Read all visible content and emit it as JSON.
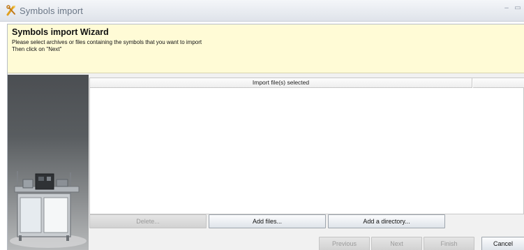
{
  "window": {
    "title": "Symbols import",
    "icon": "wrench-pencil-icon",
    "minimize_glyph": "–",
    "maximize_glyph": "▭"
  },
  "banner": {
    "wizard_title": "Symbols import Wizard",
    "line1": "Please select archives or files containing the symbols that you want to import",
    "line2": "Then click on \"Next\"",
    "background": "#fffbd6"
  },
  "table": {
    "column_header": "Import file(s) selected",
    "rows": []
  },
  "file_buttons": {
    "delete_label": "Delete...",
    "add_files_label": "Add files...",
    "add_directory_label": "Add a directory..."
  },
  "nav_buttons": {
    "previous_label": "Previous",
    "next_label": "Next",
    "finish_label": "Finish",
    "cancel_label": "Cancel"
  }
}
